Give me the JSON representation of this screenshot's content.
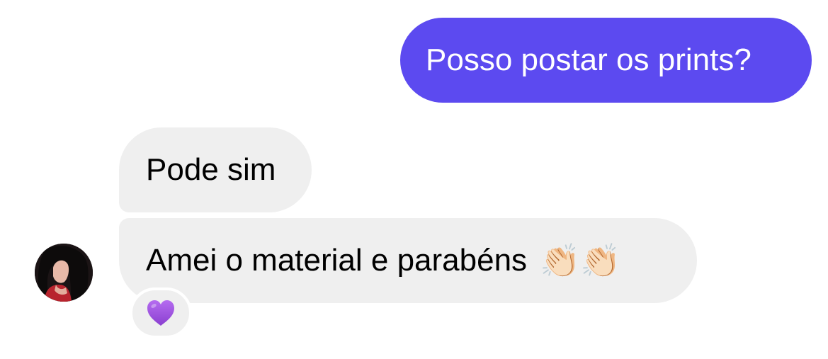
{
  "conversation": {
    "messages": [
      {
        "direction": "sent",
        "text": "Posso postar os prints?"
      },
      {
        "direction": "received",
        "text": "Pode sim"
      },
      {
        "direction": "received",
        "text": "Amei o material e parabéns",
        "emoji": "👏🏻👏🏻"
      }
    ],
    "reaction": {
      "emoji": "💜",
      "icon": "purple-heart-icon"
    },
    "avatar": {
      "icon": "contact-avatar"
    }
  },
  "colors": {
    "sent_bubble": "#5c4af0",
    "received_bubble": "#efefef",
    "heart": "#9b4fd8"
  }
}
